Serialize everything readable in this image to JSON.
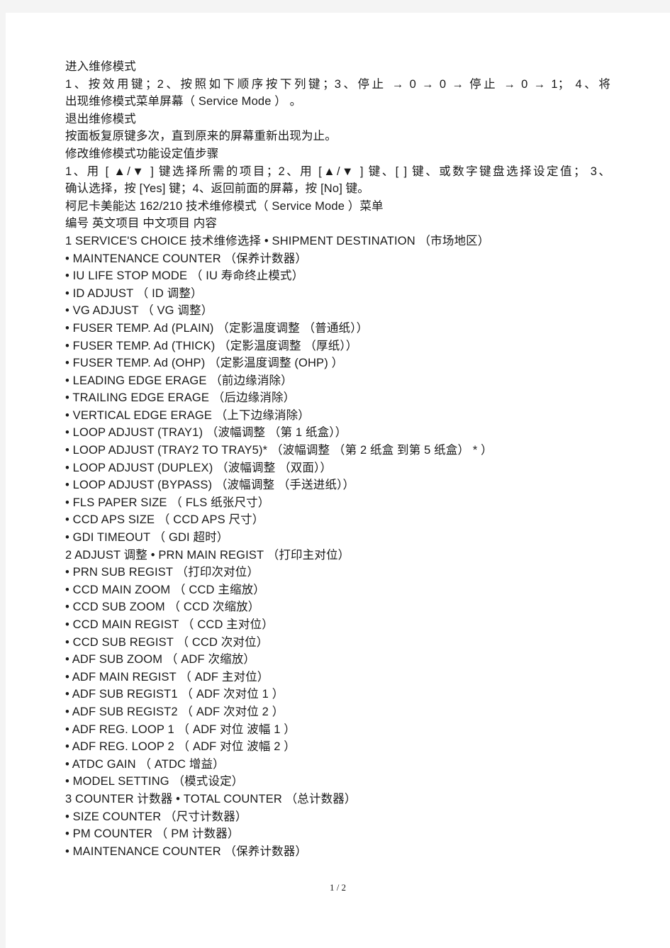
{
  "document": {
    "page_indicator": "1 / 2",
    "body_lines": [
      {
        "text": "进入维修模式",
        "justify": false
      },
      {
        "text": "1、按效用键；2、按照如下顺序按下列键；3、停止 → 0 → 0 →  停止 → 0 → 1；  4、将",
        "justify": true
      },
      {
        "text": "出现维修模式菜单屏幕（ Service Mode ） 。",
        "justify": false
      },
      {
        "text": "退出维修模式",
        "justify": false
      },
      {
        "text": "按面板复原键多次，直到原来的屏幕重新出现为止。",
        "justify": false
      },
      {
        "text": "修改维修模式功能设定值步骤",
        "justify": false
      },
      {
        "text": "1、用 [ ▲/▼ ] 键选择所需的项目；2、用 [▲/▼ ] 键、[ ] 键、或数字键盘选择设定值； 3、",
        "justify": true
      },
      {
        "text": "确认选择，按 [Yes] 键；4、返回前面的屏幕，按 [No] 键。",
        "justify": false
      },
      {
        "text": "柯尼卡美能达 162/210 技术维修模式（ Service Mode ）菜单",
        "justify": false
      },
      {
        "text": "编号  英文项目  中文项目  内容",
        "justify": false
      },
      {
        "text": "1 SERVICE'S CHOICE  技术维修选择 • SHIPMENT DESTINATION （市场地区）",
        "justify": false
      },
      {
        "text": "• MAINTENANCE COUNTER （保养计数器）",
        "justify": false
      },
      {
        "text": "• IU LIFE STOP MODE （ IU 寿命终止模式）",
        "justify": false
      },
      {
        "text": "• ID ADJUST （ ID 调整）",
        "justify": false
      },
      {
        "text": "• VG ADJUST （ VG 调整）",
        "justify": false
      },
      {
        "text": "• FUSER TEMP. Ad (PLAIN) （定影温度调整 （普通纸））",
        "justify": false
      },
      {
        "text": "• FUSER TEMP. Ad (THICK) （定影温度调整 （厚纸））",
        "justify": false
      },
      {
        "text": "• FUSER TEMP. Ad (OHP) （定影温度调整 (OHP) ）",
        "justify": false
      },
      {
        "text": "• LEADING EDGE ERAGE （前边缘消除）",
        "justify": false
      },
      {
        "text": "• TRAILING EDGE ERAGE （后边缘消除）",
        "justify": false
      },
      {
        "text": "• VERTICAL EDGE ERAGE （上下边缘消除）",
        "justify": false
      },
      {
        "text": "• LOOP ADJUST (TRAY1) （波幅调整 （第 1 纸盒））",
        "justify": false
      },
      {
        "text": "• LOOP ADJUST (TRAY2 TO TRAY5)* （波幅调整 （第 2 纸盒 到第 5 纸盒） * ）",
        "justify": false
      },
      {
        "text": "• LOOP ADJUST (DUPLEX) （波幅调整 （双面））",
        "justify": false
      },
      {
        "text": "• LOOP ADJUST (BYPASS) （波幅调整 （手送进纸））",
        "justify": false
      },
      {
        "text": "• FLS PAPER SIZE （ FLS 纸张尺寸）",
        "justify": false
      },
      {
        "text": "• CCD APS SIZE （ CCD APS 尺寸）",
        "justify": false
      },
      {
        "text": "• GDI TIMEOUT （ GDI 超时）",
        "justify": false
      },
      {
        "text": "2 ADJUST 调整 • PRN MAIN REGIST （打印主对位）",
        "justify": false
      },
      {
        "text": "• PRN SUB REGIST （打印次对位）",
        "justify": false
      },
      {
        "text": "• CCD MAIN ZOOM （ CCD 主缩放）",
        "justify": false
      },
      {
        "text": "• CCD SUB ZOOM （ CCD 次缩放）",
        "justify": false
      },
      {
        "text": "• CCD MAIN REGIST （ CCD 主对位）",
        "justify": false
      },
      {
        "text": "• CCD SUB REGIST （ CCD 次对位）",
        "justify": false
      },
      {
        "text": "• ADF SUB ZOOM （ ADF 次缩放）",
        "justify": false
      },
      {
        "text": "• ADF MAIN REGIST （ ADF 主对位）",
        "justify": false
      },
      {
        "text": "• ADF SUB REGIST1 （ ADF 次对位 1 ）",
        "justify": false
      },
      {
        "text": "• ADF SUB REGIST2 （ ADF 次对位 2 ）",
        "justify": false
      },
      {
        "text": "• ADF REG. LOOP 1 （ ADF 对位 波幅 1 ）",
        "justify": false
      },
      {
        "text": "• ADF REG. LOOP 2 （ ADF 对位 波幅 2 ）",
        "justify": false
      },
      {
        "text": "• ATDC GAIN （ ATDC 增益）",
        "justify": false
      },
      {
        "text": "• MODEL SETTING （模式设定）",
        "justify": false
      },
      {
        "text": "3 COUNTER 计数器 • TOTAL COUNTER （总计数器）",
        "justify": false
      },
      {
        "text": "• SIZE COUNTER （尺寸计数器）",
        "justify": false
      },
      {
        "text": "• PM COUNTER （ PM 计数器）",
        "justify": false
      },
      {
        "text": "• MAINTENANCE COUNTER （保养计数器）",
        "justify": false
      }
    ]
  }
}
